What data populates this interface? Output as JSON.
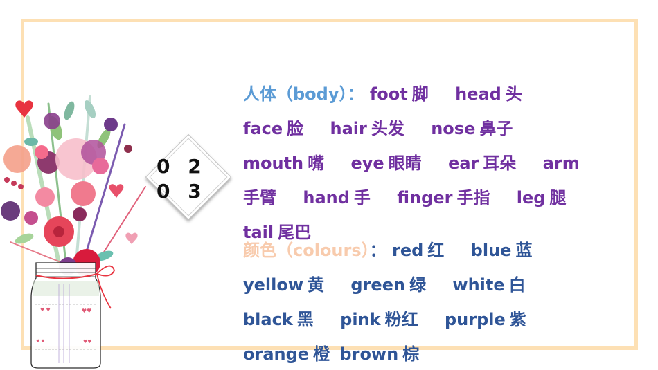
{
  "section_number": "0 2 0 3",
  "section_number_lines": [
    "0 2",
    "0 3"
  ],
  "colors": {
    "frame": "#fde0b4",
    "body_heading": "#5b9bd5",
    "body_words": "#7030a0",
    "colour_heading": "#f8cbad",
    "colour_words": "#2f5597"
  },
  "body": {
    "heading": "人体（body）",
    "separator": "：",
    "words": [
      {
        "en": "foot",
        "zh": "脚"
      },
      {
        "en": "head",
        "zh": "头"
      },
      {
        "en": "face",
        "zh": "脸"
      },
      {
        "en": "hair",
        "zh": "头发"
      },
      {
        "en": "nose",
        "zh": "鼻子"
      },
      {
        "en": "mouth",
        "zh": "嘴"
      },
      {
        "en": "eye",
        "zh": "眼睛"
      },
      {
        "en": "ear",
        "zh": "耳朵"
      },
      {
        "en": "arm",
        "zh": "手臂"
      },
      {
        "en": "hand",
        "zh": "手"
      },
      {
        "en": "finger",
        "zh": "手指"
      },
      {
        "en": "leg",
        "zh": "腿"
      },
      {
        "en": "tail",
        "zh": "尾巴"
      }
    ]
  },
  "colours": {
    "heading": "颜色（colours）",
    "separator": "：",
    "words": [
      {
        "en": "red",
        "zh": "红"
      },
      {
        "en": "blue",
        "zh": "蓝"
      },
      {
        "en": "yellow",
        "zh": "黄"
      },
      {
        "en": "green",
        "zh": "绿"
      },
      {
        "en": "white",
        "zh": "白"
      },
      {
        "en": "black",
        "zh": "黑"
      },
      {
        "en": "pink",
        "zh": "粉红"
      },
      {
        "en": "purple",
        "zh": "紫"
      },
      {
        "en": "orange",
        "zh": "橙"
      },
      {
        "en": "brown",
        "zh": "棕"
      }
    ]
  },
  "image": {
    "alt": "watercolor flower bouquet in mason jar"
  }
}
